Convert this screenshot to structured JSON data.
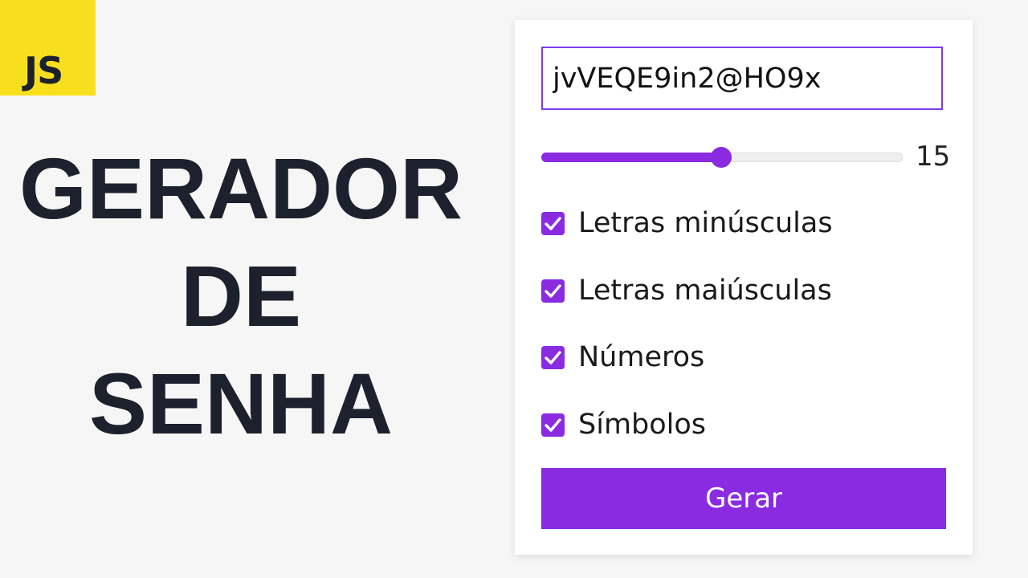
{
  "logo": {
    "text": "JS",
    "color": "#f7df1e"
  },
  "hero": {
    "lines": [
      "GERADOR",
      "DE",
      "SENHA"
    ]
  },
  "generator": {
    "password": "jvVEQE9in2@HO9x",
    "length": 15,
    "length_fraction": 0.5,
    "options": [
      {
        "label": "Letras minúsculas",
        "checked": true
      },
      {
        "label": "Letras maiúsculas",
        "checked": true
      },
      {
        "label": "Números",
        "checked": true
      },
      {
        "label": "Símbolos",
        "checked": true
      }
    ],
    "button_label": "Gerar"
  },
  "colors": {
    "accent": "#8a2be2",
    "background": "#f6f6f6",
    "text": "#1d212d"
  },
  "icons": {
    "checkbox": "check-icon"
  }
}
